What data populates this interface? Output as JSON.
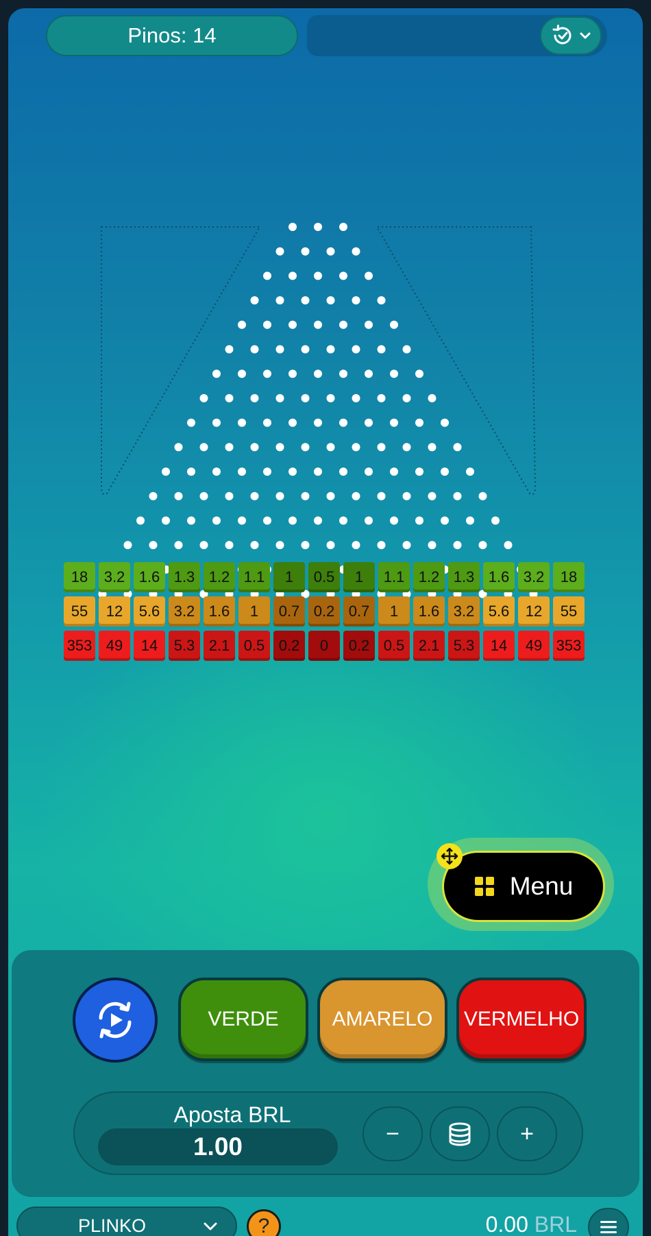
{
  "header": {
    "pins_label": "Pinos: 14",
    "history_icon": "history-check-icon",
    "dropdown_icon": "chevron-down-icon"
  },
  "board": {
    "pin_rows": 14,
    "pin_color": "#ffffff",
    "rows": {
      "green": [
        "18",
        "3.2",
        "1.6",
        "1.3",
        "1.2",
        "1.1",
        "1",
        "0.5",
        "1",
        "1.1",
        "1.2",
        "1.3",
        "1.6",
        "3.2",
        "18"
      ],
      "yellow": [
        "55",
        "12",
        "5.6",
        "3.2",
        "1.6",
        "1",
        "0.7",
        "0.2",
        "0.7",
        "1",
        "1.6",
        "3.2",
        "5.6",
        "12",
        "55"
      ],
      "red": [
        "353",
        "49",
        "14",
        "5.3",
        "2.1",
        "0.5",
        "0.2",
        "0",
        "0.2",
        "0.5",
        "2.1",
        "5.3",
        "14",
        "49",
        "353"
      ]
    }
  },
  "menu": {
    "label": "Menu",
    "icon": "grid-icon",
    "handle_icon": "move-icon"
  },
  "controls": {
    "autoplay_icon": "autoplay-icon",
    "green_label": "VERDE",
    "yellow_label": "AMARELO",
    "red_label": "VERMELHO",
    "colors": {
      "green": "#3f8f0d",
      "yellow": "#d9952e",
      "red": "#e11212"
    }
  },
  "bet": {
    "label": "Aposta BRL",
    "value": "1.00",
    "minus": "−",
    "plus": "+",
    "coins_icon": "coins-icon"
  },
  "footer": {
    "game_name": "PLINKO",
    "help": "?",
    "balance_amount": "0.00",
    "balance_currency": "BRL"
  }
}
